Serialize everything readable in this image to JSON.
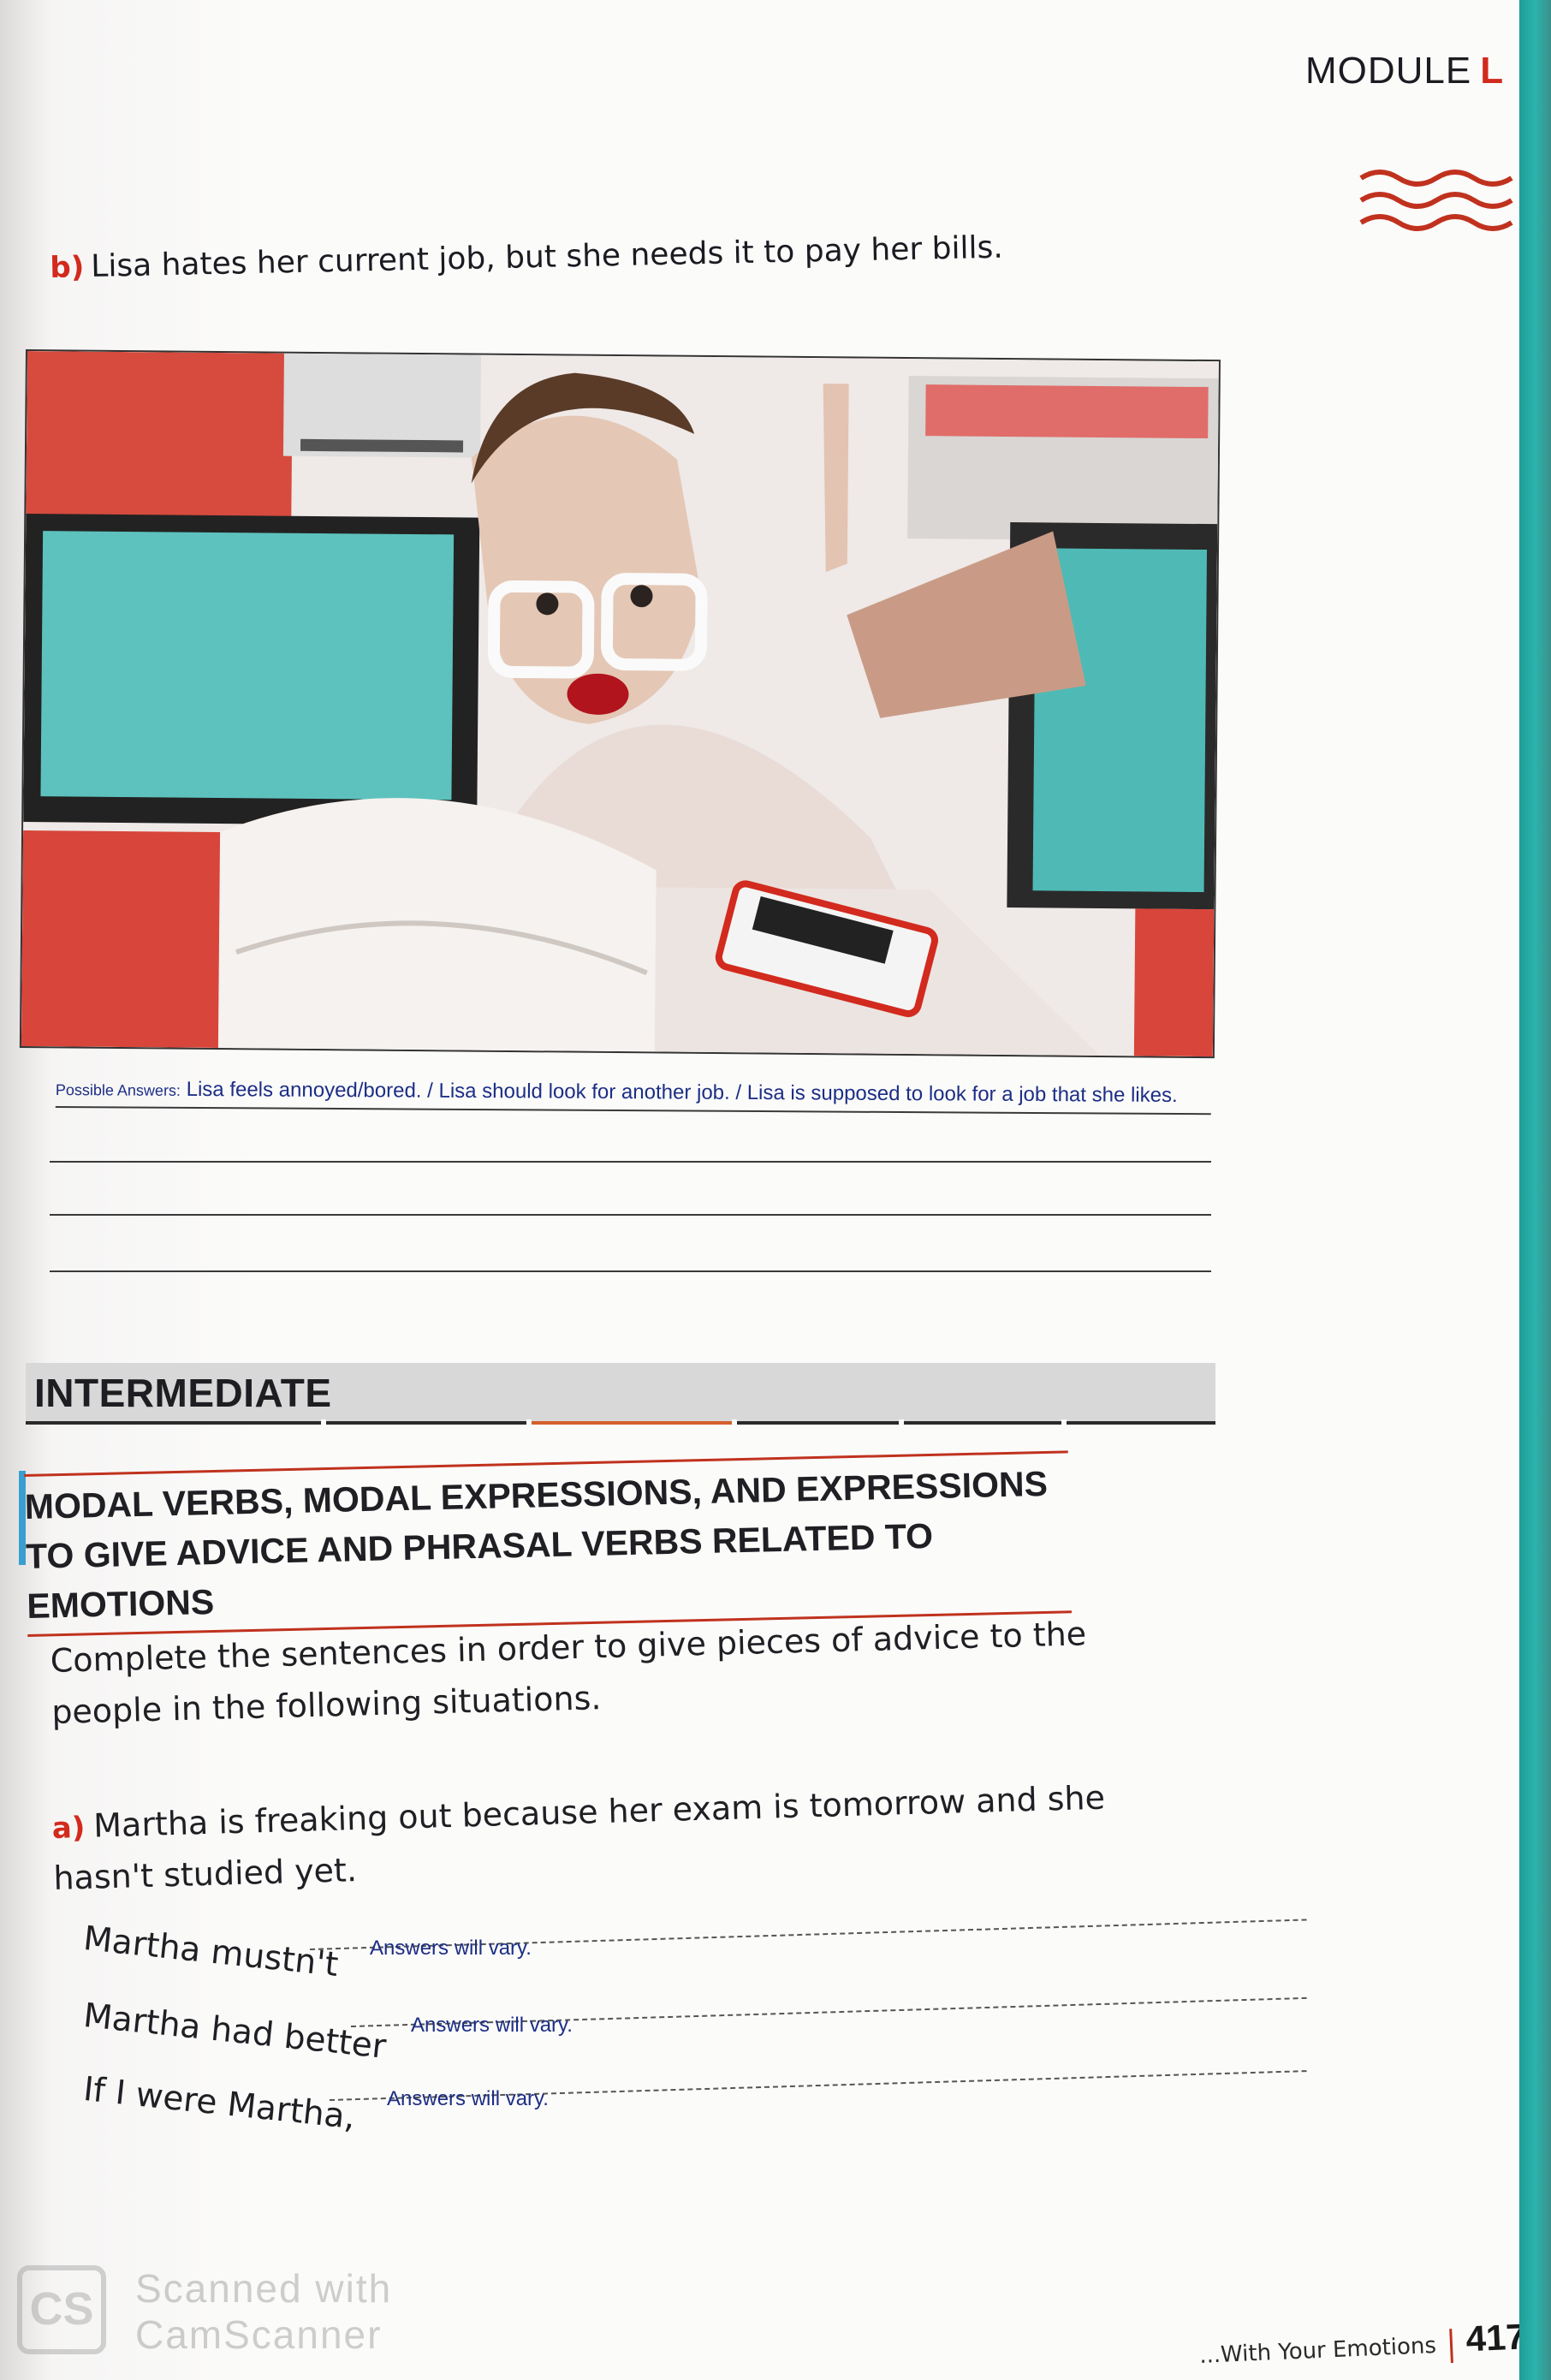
{
  "header": {
    "module_label": "MODULE",
    "module_letter": "L"
  },
  "exercise_b": {
    "marker": "b)",
    "text": "Lisa hates her current job, but she needs it to pay her bills.",
    "answer_label": "Possible Answers:",
    "answer_text": "Lisa feels annoyed/bored. / Lisa should look for another job. / Lisa is supposed to look for a job that she likes."
  },
  "level": {
    "title": "INTERMEDIATE"
  },
  "section": {
    "title_line1": "MODAL VERBS, MODAL EXPRESSIONS, AND EXPRESSIONS",
    "title_line2": "TO GIVE ADVICE AND PHRASAL VERBS RELATED TO EMOTIONS"
  },
  "instructions": "Complete the sentences in order to give pieces of advice to the people in the following situations.",
  "exercise_a": {
    "marker": "a)",
    "text": "Martha is freaking out because her exam is tomorrow and she hasn't studied yet.",
    "items": [
      {
        "stem": "Martha mustn't",
        "answer": "Answers will vary."
      },
      {
        "stem": "Martha had better",
        "answer": "Answers will vary."
      },
      {
        "stem": "If I were Martha,",
        "answer": "Answers will vary."
      }
    ]
  },
  "watermark": {
    "line1": "Scanned with",
    "line2": "CamScanner",
    "logo": "CS"
  },
  "footer": {
    "chapter": "...With Your Emotions",
    "page_number": "417"
  },
  "colors": {
    "accent_red": "#d22a1e",
    "answer_blue": "#1c2e85",
    "teal_edge": "#2bb3ad"
  }
}
